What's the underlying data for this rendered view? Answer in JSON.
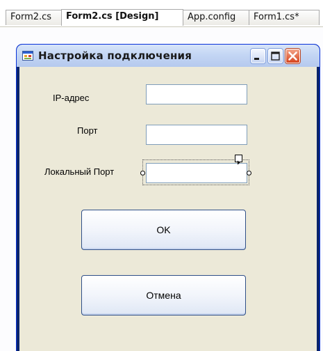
{
  "tabs": [
    {
      "label": "Form2.cs",
      "active": false
    },
    {
      "label": "Form2.cs [Design]",
      "active": true
    },
    {
      "label": "App.config",
      "active": false
    },
    {
      "label": "Form1.cs*",
      "active": false
    }
  ],
  "window": {
    "title": "Настройка подключения",
    "icon": "form-icon"
  },
  "form": {
    "ip_label": "IP-адрес",
    "port_label": "Порт",
    "local_port_label": "Локальный Порт",
    "ip_value": "",
    "port_value": "",
    "local_port_value": ""
  },
  "buttons": {
    "ok_label": "OK",
    "cancel_label": "Отмена"
  },
  "colors": {
    "titlebar": "#c4d6f4",
    "client": "#ece9d8",
    "close_button": "#d6431c"
  }
}
